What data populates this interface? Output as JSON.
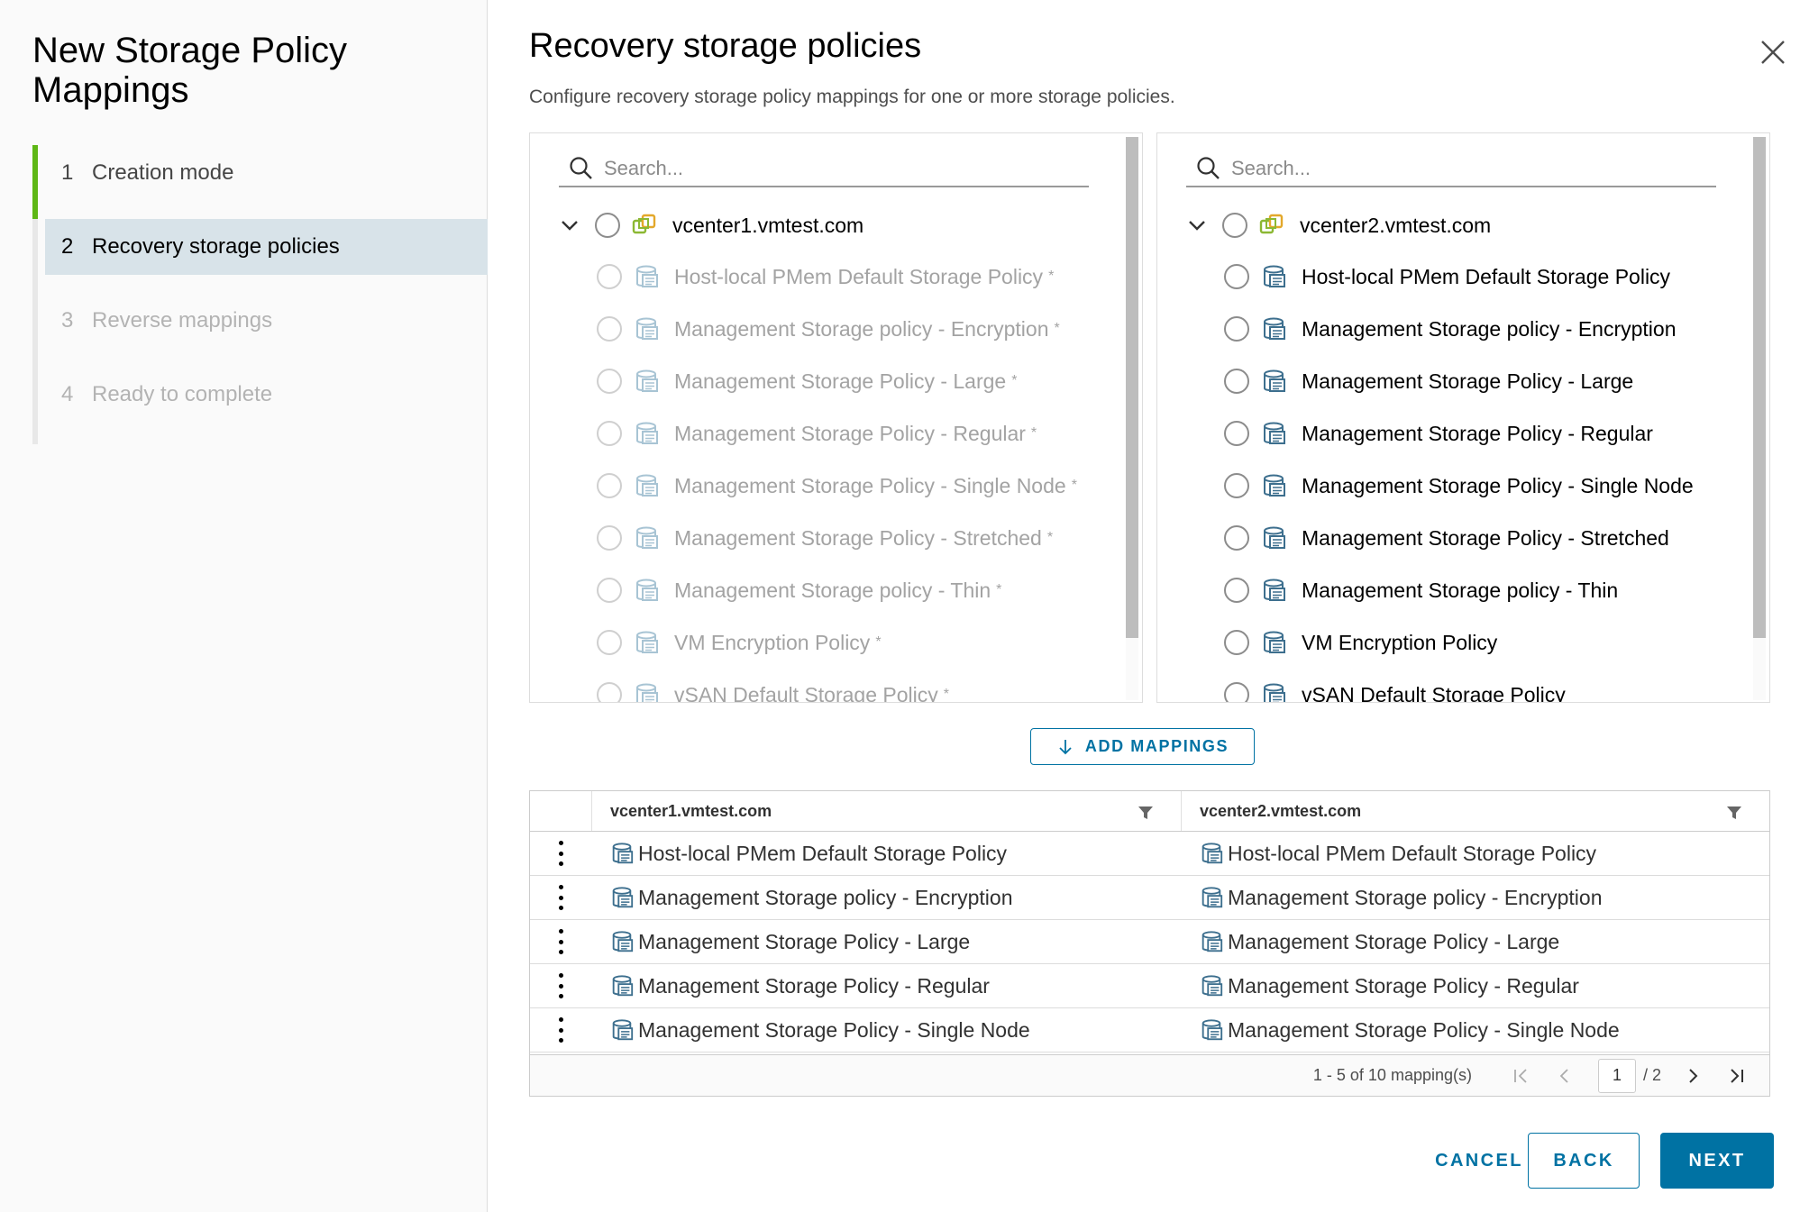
{
  "wizard": {
    "title": "New Storage Policy Mappings",
    "steps": [
      {
        "num": "1",
        "label": "Creation mode"
      },
      {
        "num": "2",
        "label": "Recovery storage policies"
      },
      {
        "num": "3",
        "label": "Reverse mappings"
      },
      {
        "num": "4",
        "label": "Ready to complete"
      }
    ]
  },
  "page": {
    "title": "Recovery storage policies",
    "subtitle": "Configure recovery storage policy mappings for one or more storage policies."
  },
  "left_tree": {
    "search_placeholder": "Search...",
    "root": "vcenter1.vmtest.com",
    "items": [
      "Host-local PMem Default Storage Policy",
      "Management Storage policy - Encryption",
      "Management Storage Policy - Large",
      "Management Storage Policy - Regular",
      "Management Storage Policy - Single Node",
      "Management Storage Policy - Stretched",
      "Management Storage policy - Thin",
      "VM Encryption Policy",
      "vSAN Default Storage Policy"
    ],
    "item_suffix": "*"
  },
  "right_tree": {
    "search_placeholder": "Search...",
    "root": "vcenter2.vmtest.com",
    "items": [
      "Host-local PMem Default Storage Policy",
      "Management Storage policy - Encryption",
      "Management Storage Policy - Large",
      "Management Storage Policy - Regular",
      "Management Storage Policy - Single Node",
      "Management Storage Policy - Stretched",
      "Management Storage policy - Thin",
      "VM Encryption Policy",
      "vSAN Default Storage Policy"
    ]
  },
  "add_mappings_label": "ADD MAPPINGS",
  "grid": {
    "columns": [
      "vcenter1.vmtest.com",
      "vcenter2.vmtest.com"
    ],
    "rows": [
      [
        "Host-local PMem Default Storage Policy",
        "Host-local PMem Default Storage Policy"
      ],
      [
        "Management Storage policy - Encryption",
        "Management Storage policy - Encryption"
      ],
      [
        "Management Storage Policy - Large",
        "Management Storage Policy - Large"
      ],
      [
        "Management Storage Policy - Regular",
        "Management Storage Policy - Regular"
      ],
      [
        "Management Storage Policy - Single Node",
        "Management Storage Policy - Single Node"
      ]
    ],
    "pager_text": "1 - 5 of 10 mapping(s)",
    "current_page": "1",
    "total_pages": "/ 2"
  },
  "buttons": {
    "cancel": "CANCEL",
    "back": "BACK",
    "next": "NEXT"
  },
  "colors": {
    "accent": "#0072a3",
    "step_active": "#5eb715",
    "step_current_bg": "#d8e3e9"
  },
  "icons": {
    "close": "close-icon",
    "search": "search-icon",
    "chevron": "chevron-down-icon",
    "vcenter": "vcenter-icon",
    "policy": "storage-policy-icon",
    "filter": "filter-icon",
    "kebab": "kebab-menu-icon",
    "arrow_down": "arrow-down-icon"
  }
}
